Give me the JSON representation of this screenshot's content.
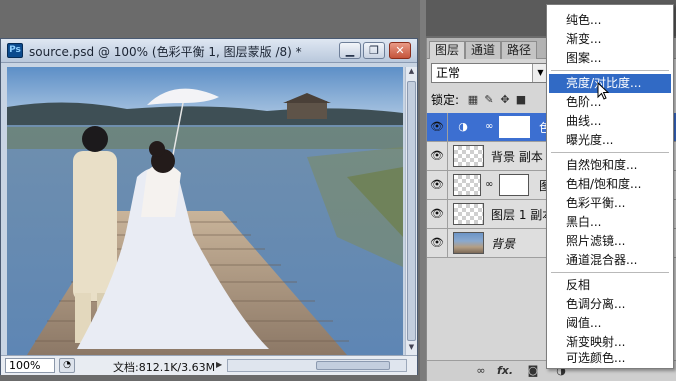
{
  "document": {
    "ps_badge": "Ps",
    "title": "source.psd @ 100% (色彩平衡 1, 图层蒙版 /8) *",
    "window_buttons": {
      "minimize": "▁",
      "restore": "❐",
      "close": "✕"
    },
    "zoom": "100%",
    "doc_size": "文档:812.1K/3.63M"
  },
  "layers_panel": {
    "tabs": [
      "图层",
      "通道",
      "路径"
    ],
    "blend_mode": "正常",
    "lock_label": "锁定:",
    "layers": [
      {
        "name": "色",
        "type": "adjustment",
        "selected": true,
        "visible": true
      },
      {
        "name": "背景 副本",
        "type": "pixel",
        "selected": false,
        "visible": true
      },
      {
        "name": "图",
        "type": "masked",
        "selected": false,
        "visible": true
      },
      {
        "name": "图层 1 副本",
        "type": "pixel",
        "selected": false,
        "visible": true
      },
      {
        "name": "背景",
        "type": "background",
        "selected": false,
        "visible": true
      }
    ],
    "footer_fx": "fx."
  },
  "adjustment_menu": {
    "group1": [
      "纯色...",
      "渐变...",
      "图案..."
    ],
    "group2": [
      "亮度/对比度...",
      "色阶...",
      "曲线...",
      "曝光度..."
    ],
    "group3": [
      "自然饱和度...",
      "色相/饱和度...",
      "色彩平衡...",
      "黑白...",
      "照片滤镜...",
      "通道混合器..."
    ],
    "group4": [
      "反相",
      "色调分离...",
      "阈值...",
      "渐变映射...",
      "可选颜色..."
    ],
    "hovered": "亮度/对比度..."
  },
  "colors": {
    "selection_blue": "#3c6fd1",
    "menu_hover": "#316ac5"
  }
}
